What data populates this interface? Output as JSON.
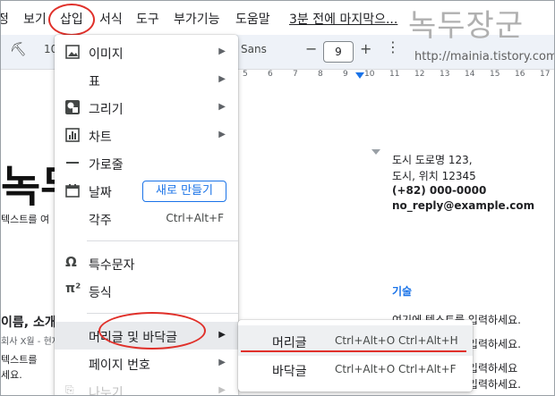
{
  "menubar": {
    "items": [
      "정",
      "보기",
      "삽입",
      "서식",
      "도구",
      "부가기능",
      "도움말"
    ],
    "last_edit": "3분 전에 마지막으..."
  },
  "toolbar": {
    "font_size_left": "10",
    "font_name": "Sans",
    "font_size": "9",
    "minus": "−",
    "plus": "+"
  },
  "ruler": [
    "5",
    "6",
    "7",
    "8",
    "9",
    "10",
    "11",
    "12",
    "13",
    "14",
    "15",
    "16",
    "17"
  ],
  "watermark": {
    "title": "녹두장군",
    "url": "http://mainia.tistory.com"
  },
  "document": {
    "big_title": "녹두",
    "text_snip": "텍스트를 여",
    "address_1": "도시 도로명 123,",
    "address_2": "도시, 위치 12345",
    "phone": "(+82) 000-0000",
    "email": "no_reply@example.com",
    "skills": "기술",
    "name_line": "이름, 소개",
    "job_line": "회사 X월 - 현재",
    "text_left_1": "텍스트를",
    "text_left_2": "세요.",
    "right_1": "여기에 텍스트를 입력하세요.",
    "right_2": "여기에 텍스트를 입력하세요.",
    "right_3": "여기에 텍스트를 입력하세요",
    "right_4": "여기에 텍스트를 입력하세요."
  },
  "insert_menu": {
    "image": "이미지",
    "table": "표",
    "drawing": "그리기",
    "chart": "차트",
    "hline": "가로줄",
    "date": "날짜",
    "new_button": "새로 만들기",
    "footnote": "각주",
    "footnote_shortcut": "Ctrl+Alt+F",
    "special_chars": "특수문자",
    "equation": "등식",
    "header_footer": "머리글 및 바닥글",
    "page_number": "페이지 번호",
    "break": "나누기"
  },
  "submenu": {
    "header": "머리글",
    "header_shortcut": "Ctrl+Alt+O Ctrl+Alt+H",
    "footer": "바닥글",
    "footer_shortcut": "Ctrl+Alt+O Ctrl+Alt+F"
  },
  "colors": {
    "accent": "#1a73e8",
    "annotation": "#e0302a",
    "highlight": "#e8eaed"
  }
}
